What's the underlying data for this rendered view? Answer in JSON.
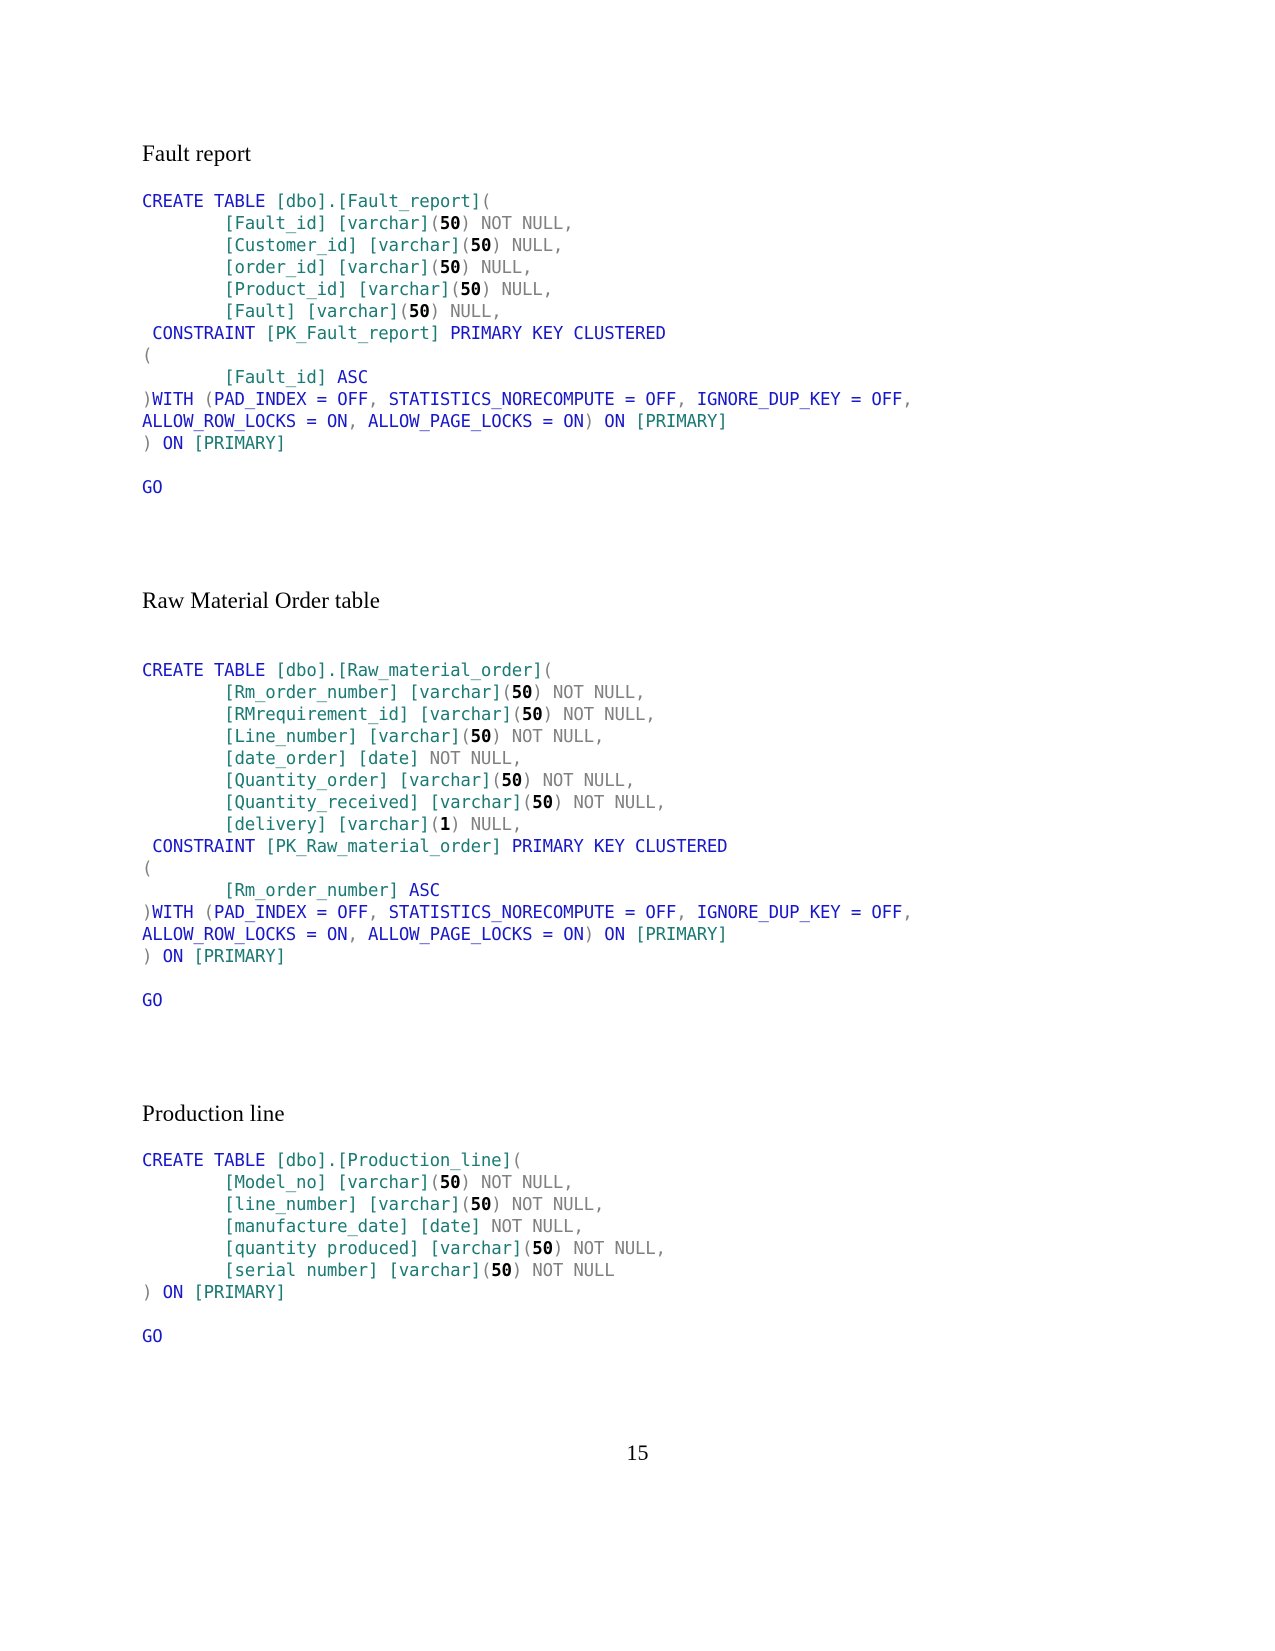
{
  "document": {
    "page_number": "15",
    "sections": [
      {
        "heading": "Fault report",
        "heading_indent": false,
        "code_lines": [
          [
            {
              "t": "CREATE TABLE ",
              "c": "kw"
            },
            {
              "t": "[dbo].[Fault_report]",
              "c": "id"
            },
            {
              "t": "(",
              "c": "punct"
            }
          ],
          [
            {
              "t": "        ",
              "c": "pl"
            },
            {
              "t": "[Fault_id] [varchar]",
              "c": "id"
            },
            {
              "t": "(",
              "c": "punct"
            },
            {
              "t": "50",
              "c": "num"
            },
            {
              "t": ") NOT NULL,",
              "c": "pl"
            }
          ],
          [
            {
              "t": "        ",
              "c": "pl"
            },
            {
              "t": "[Customer_id] [varchar]",
              "c": "id"
            },
            {
              "t": "(",
              "c": "punct"
            },
            {
              "t": "50",
              "c": "num"
            },
            {
              "t": ") NULL,",
              "c": "pl"
            }
          ],
          [
            {
              "t": "        ",
              "c": "pl"
            },
            {
              "t": "[order_id] [varchar]",
              "c": "id"
            },
            {
              "t": "(",
              "c": "punct"
            },
            {
              "t": "50",
              "c": "num"
            },
            {
              "t": ") NULL,",
              "c": "pl"
            }
          ],
          [
            {
              "t": "        ",
              "c": "pl"
            },
            {
              "t": "[Product_id] [varchar]",
              "c": "id"
            },
            {
              "t": "(",
              "c": "punct"
            },
            {
              "t": "50",
              "c": "num"
            },
            {
              "t": ") NULL,",
              "c": "pl"
            }
          ],
          [
            {
              "t": "        ",
              "c": "pl"
            },
            {
              "t": "[Fault] [varchar]",
              "c": "id"
            },
            {
              "t": "(",
              "c": "punct"
            },
            {
              "t": "50",
              "c": "num"
            },
            {
              "t": ") NULL,",
              "c": "pl"
            }
          ],
          [
            {
              "t": " ",
              "c": "pl"
            },
            {
              "t": "CONSTRAINT ",
              "c": "kw"
            },
            {
              "t": "[PK_Fault_report]",
              "c": "id"
            },
            {
              "t": " ",
              "c": "pl"
            },
            {
              "t": "PRIMARY KEY CLUSTERED",
              "c": "kw"
            }
          ],
          [
            {
              "t": "(",
              "c": "punct"
            }
          ],
          [
            {
              "t": "        ",
              "c": "pl"
            },
            {
              "t": "[Fault_id]",
              "c": "id"
            },
            {
              "t": " ",
              "c": "pl"
            },
            {
              "t": "ASC",
              "c": "kw"
            }
          ],
          [
            {
              "t": ")",
              "c": "punct"
            },
            {
              "t": "WITH ",
              "c": "kw"
            },
            {
              "t": "(",
              "c": "punct"
            },
            {
              "t": "PAD_INDEX",
              "c": "kw"
            },
            {
              "t": " ",
              "c": "pl"
            },
            {
              "t": "=",
              "c": "kw"
            },
            {
              "t": " ",
              "c": "pl"
            },
            {
              "t": "OFF",
              "c": "kw"
            },
            {
              "t": ",",
              "c": "punct"
            },
            {
              "t": " ",
              "c": "pl"
            },
            {
              "t": "STATISTICS_NORECOMPUTE",
              "c": "kw"
            },
            {
              "t": " ",
              "c": "pl"
            },
            {
              "t": "=",
              "c": "kw"
            },
            {
              "t": " ",
              "c": "pl"
            },
            {
              "t": "OFF",
              "c": "kw"
            },
            {
              "t": ",",
              "c": "punct"
            },
            {
              "t": " ",
              "c": "pl"
            },
            {
              "t": "IGNORE_DUP_KEY",
              "c": "kw"
            },
            {
              "t": " ",
              "c": "pl"
            },
            {
              "t": "=",
              "c": "kw"
            },
            {
              "t": " ",
              "c": "pl"
            },
            {
              "t": "OFF",
              "c": "kw"
            },
            {
              "t": ",",
              "c": "punct"
            }
          ],
          [
            {
              "t": "ALLOW_ROW_LOCKS",
              "c": "kw"
            },
            {
              "t": " ",
              "c": "pl"
            },
            {
              "t": "=",
              "c": "kw"
            },
            {
              "t": " ",
              "c": "pl"
            },
            {
              "t": "ON",
              "c": "kw"
            },
            {
              "t": ",",
              "c": "punct"
            },
            {
              "t": " ",
              "c": "pl"
            },
            {
              "t": "ALLOW_PAGE_LOCKS",
              "c": "kw"
            },
            {
              "t": " ",
              "c": "pl"
            },
            {
              "t": "=",
              "c": "kw"
            },
            {
              "t": " ",
              "c": "pl"
            },
            {
              "t": "ON",
              "c": "kw"
            },
            {
              "t": ")",
              "c": "punct"
            },
            {
              "t": " ",
              "c": "pl"
            },
            {
              "t": "ON",
              "c": "kw"
            },
            {
              "t": " ",
              "c": "pl"
            },
            {
              "t": "[PRIMARY]",
              "c": "id"
            }
          ],
          [
            {
              "t": ")",
              "c": "punct"
            },
            {
              "t": " ",
              "c": "pl"
            },
            {
              "t": "ON",
              "c": "kw"
            },
            {
              "t": " ",
              "c": "pl"
            },
            {
              "t": "[PRIMARY]",
              "c": "id"
            }
          ],
          [],
          [
            {
              "t": "GO",
              "c": "go"
            }
          ]
        ]
      },
      {
        "heading": "Raw Material Order table",
        "heading_indent": true,
        "code_lines": [
          [
            {
              "t": "CREATE TABLE ",
              "c": "kw"
            },
            {
              "t": "[dbo].[Raw_material_order]",
              "c": "id"
            },
            {
              "t": "(",
              "c": "punct"
            }
          ],
          [
            {
              "t": "        ",
              "c": "pl"
            },
            {
              "t": "[Rm_order_number] [varchar]",
              "c": "id"
            },
            {
              "t": "(",
              "c": "punct"
            },
            {
              "t": "50",
              "c": "num"
            },
            {
              "t": ") NOT NULL,",
              "c": "pl"
            }
          ],
          [
            {
              "t": "        ",
              "c": "pl"
            },
            {
              "t": "[RMrequirement_id] [varchar]",
              "c": "id"
            },
            {
              "t": "(",
              "c": "punct"
            },
            {
              "t": "50",
              "c": "num"
            },
            {
              "t": ") NOT NULL,",
              "c": "pl"
            }
          ],
          [
            {
              "t": "        ",
              "c": "pl"
            },
            {
              "t": "[Line_number] [varchar]",
              "c": "id"
            },
            {
              "t": "(",
              "c": "punct"
            },
            {
              "t": "50",
              "c": "num"
            },
            {
              "t": ") NOT NULL,",
              "c": "pl"
            }
          ],
          [
            {
              "t": "        ",
              "c": "pl"
            },
            {
              "t": "[date_order] [date]",
              "c": "id"
            },
            {
              "t": " NOT NULL,",
              "c": "pl"
            }
          ],
          [
            {
              "t": "        ",
              "c": "pl"
            },
            {
              "t": "[Quantity_order] [varchar]",
              "c": "id"
            },
            {
              "t": "(",
              "c": "punct"
            },
            {
              "t": "50",
              "c": "num"
            },
            {
              "t": ") NOT NULL,",
              "c": "pl"
            }
          ],
          [
            {
              "t": "        ",
              "c": "pl"
            },
            {
              "t": "[Quantity_received] [varchar]",
              "c": "id"
            },
            {
              "t": "(",
              "c": "punct"
            },
            {
              "t": "50",
              "c": "num"
            },
            {
              "t": ") NOT NULL,",
              "c": "pl"
            }
          ],
          [
            {
              "t": "        ",
              "c": "pl"
            },
            {
              "t": "[delivery] [varchar]",
              "c": "id"
            },
            {
              "t": "(",
              "c": "punct"
            },
            {
              "t": "1",
              "c": "num"
            },
            {
              "t": ") NULL,",
              "c": "pl"
            }
          ],
          [
            {
              "t": " ",
              "c": "pl"
            },
            {
              "t": "CONSTRAINT ",
              "c": "kw"
            },
            {
              "t": "[PK_Raw_material_order]",
              "c": "id"
            },
            {
              "t": " ",
              "c": "pl"
            },
            {
              "t": "PRIMARY KEY CLUSTERED",
              "c": "kw"
            }
          ],
          [
            {
              "t": "(",
              "c": "punct"
            }
          ],
          [
            {
              "t": "        ",
              "c": "pl"
            },
            {
              "t": "[Rm_order_number]",
              "c": "id"
            },
            {
              "t": " ",
              "c": "pl"
            },
            {
              "t": "ASC",
              "c": "kw"
            }
          ],
          [
            {
              "t": ")",
              "c": "punct"
            },
            {
              "t": "WITH ",
              "c": "kw"
            },
            {
              "t": "(",
              "c": "punct"
            },
            {
              "t": "PAD_INDEX",
              "c": "kw"
            },
            {
              "t": " ",
              "c": "pl"
            },
            {
              "t": "=",
              "c": "kw"
            },
            {
              "t": " ",
              "c": "pl"
            },
            {
              "t": "OFF",
              "c": "kw"
            },
            {
              "t": ",",
              "c": "punct"
            },
            {
              "t": " ",
              "c": "pl"
            },
            {
              "t": "STATISTICS_NORECOMPUTE",
              "c": "kw"
            },
            {
              "t": " ",
              "c": "pl"
            },
            {
              "t": "=",
              "c": "kw"
            },
            {
              "t": " ",
              "c": "pl"
            },
            {
              "t": "OFF",
              "c": "kw"
            },
            {
              "t": ",",
              "c": "punct"
            },
            {
              "t": " ",
              "c": "pl"
            },
            {
              "t": "IGNORE_DUP_KEY",
              "c": "kw"
            },
            {
              "t": " ",
              "c": "pl"
            },
            {
              "t": "=",
              "c": "kw"
            },
            {
              "t": " ",
              "c": "pl"
            },
            {
              "t": "OFF",
              "c": "kw"
            },
            {
              "t": ",",
              "c": "punct"
            }
          ],
          [
            {
              "t": "ALLOW_ROW_LOCKS",
              "c": "kw"
            },
            {
              "t": " ",
              "c": "pl"
            },
            {
              "t": "=",
              "c": "kw"
            },
            {
              "t": " ",
              "c": "pl"
            },
            {
              "t": "ON",
              "c": "kw"
            },
            {
              "t": ",",
              "c": "punct"
            },
            {
              "t": " ",
              "c": "pl"
            },
            {
              "t": "ALLOW_PAGE_LOCKS",
              "c": "kw"
            },
            {
              "t": " ",
              "c": "pl"
            },
            {
              "t": "=",
              "c": "kw"
            },
            {
              "t": " ",
              "c": "pl"
            },
            {
              "t": "ON",
              "c": "kw"
            },
            {
              "t": ")",
              "c": "punct"
            },
            {
              "t": " ",
              "c": "pl"
            },
            {
              "t": "ON",
              "c": "kw"
            },
            {
              "t": " ",
              "c": "pl"
            },
            {
              "t": "[PRIMARY]",
              "c": "id"
            }
          ],
          [
            {
              "t": ")",
              "c": "punct"
            },
            {
              "t": " ",
              "c": "pl"
            },
            {
              "t": "ON",
              "c": "kw"
            },
            {
              "t": " ",
              "c": "pl"
            },
            {
              "t": "[PRIMARY]",
              "c": "id"
            }
          ],
          [],
          [
            {
              "t": "GO",
              "c": "go"
            }
          ]
        ]
      },
      {
        "heading": "Production line",
        "heading_indent": false,
        "code_lines": [
          [
            {
              "t": "CREATE TABLE ",
              "c": "kw"
            },
            {
              "t": "[dbo].[Production_line]",
              "c": "id"
            },
            {
              "t": "(",
              "c": "punct"
            }
          ],
          [
            {
              "t": "        ",
              "c": "pl"
            },
            {
              "t": "[Model_no] [varchar]",
              "c": "id"
            },
            {
              "t": "(",
              "c": "punct"
            },
            {
              "t": "50",
              "c": "num"
            },
            {
              "t": ") NOT NULL,",
              "c": "pl"
            }
          ],
          [
            {
              "t": "        ",
              "c": "pl"
            },
            {
              "t": "[line_number] [varchar]",
              "c": "id"
            },
            {
              "t": "(",
              "c": "punct"
            },
            {
              "t": "50",
              "c": "num"
            },
            {
              "t": ") NOT NULL,",
              "c": "pl"
            }
          ],
          [
            {
              "t": "        ",
              "c": "pl"
            },
            {
              "t": "[manufacture_date] [date]",
              "c": "id"
            },
            {
              "t": " NOT NULL,",
              "c": "pl"
            }
          ],
          [
            {
              "t": "        ",
              "c": "pl"
            },
            {
              "t": "[quantity produced] [varchar]",
              "c": "id"
            },
            {
              "t": "(",
              "c": "punct"
            },
            {
              "t": "50",
              "c": "num"
            },
            {
              "t": ") NOT NULL,",
              "c": "pl"
            }
          ],
          [
            {
              "t": "        ",
              "c": "pl"
            },
            {
              "t": "[serial number] [varchar]",
              "c": "id"
            },
            {
              "t": "(",
              "c": "punct"
            },
            {
              "t": "50",
              "c": "num"
            },
            {
              "t": ") NOT NULL",
              "c": "pl"
            }
          ],
          [
            {
              "t": ")",
              "c": "punct"
            },
            {
              "t": " ",
              "c": "pl"
            },
            {
              "t": "ON",
              "c": "kw"
            },
            {
              "t": " ",
              "c": "pl"
            },
            {
              "t": "[PRIMARY]",
              "c": "id"
            }
          ],
          [],
          [
            {
              "t": "GO",
              "c": "go"
            }
          ]
        ]
      }
    ]
  },
  "colors": {
    "keyword": "#1818c8",
    "identifier": "#1a7a74",
    "plain": "#808080",
    "number": "#000000",
    "background": "#ffffff",
    "heading": "#000000"
  }
}
